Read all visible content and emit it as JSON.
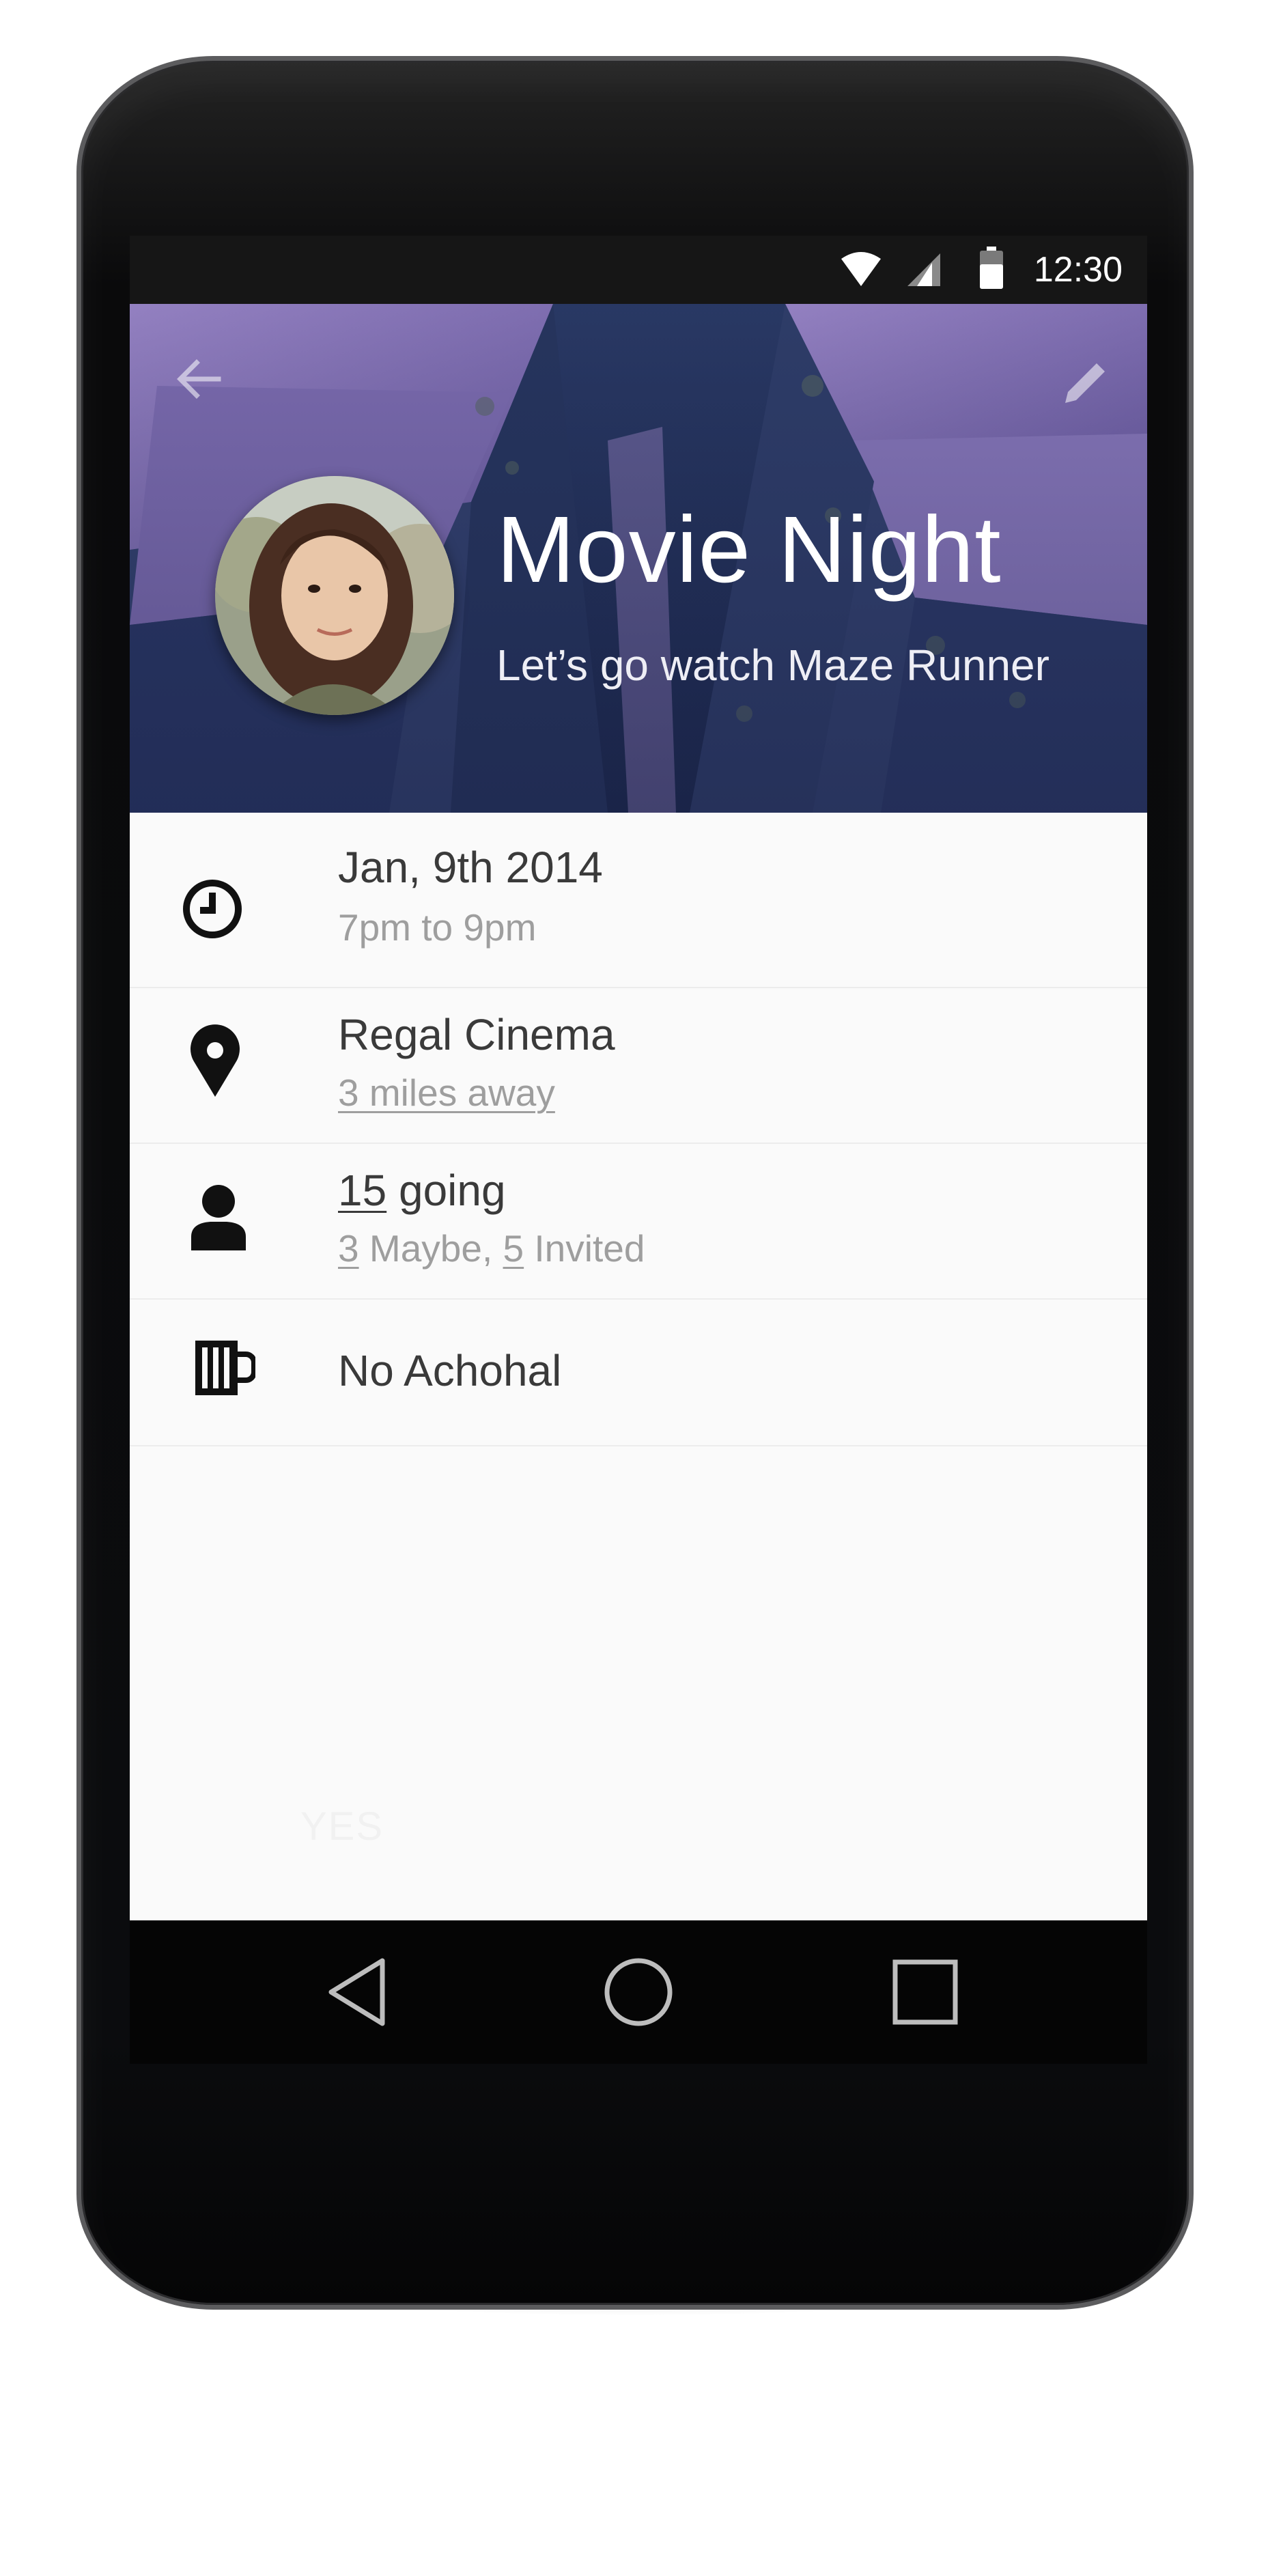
{
  "status_bar": {
    "time": "12:30",
    "icons": [
      "wifi-icon",
      "signal-icon",
      "battery-icon"
    ]
  },
  "header": {
    "back_icon": "arrow-left-icon",
    "edit_icon": "pencil-icon",
    "title": "Movie Night",
    "subtitle": "Let’s go watch Maze Runner"
  },
  "details": {
    "date": {
      "icon": "clock-icon",
      "primary": "Jan, 9th 2014",
      "secondary": "7pm to 9pm"
    },
    "location": {
      "icon": "location-pin-icon",
      "primary": "Regal Cinema",
      "secondary": "3 miles away"
    },
    "attendees": {
      "icon": "person-icon",
      "going_count": "15",
      "going_label": " going",
      "maybe_count": "3",
      "maybe_label": " Maybe, ",
      "invited_count": "5",
      "invited_label": " Invited"
    },
    "alcohol": {
      "icon": "beer-mug-icon",
      "primary": "No Achohal"
    }
  },
  "rsvp": {
    "yes_label": "YES"
  },
  "nav_bar": {
    "back_icon": "nav-back-icon",
    "home_icon": "nav-home-icon",
    "recents_icon": "nav-recents-icon"
  },
  "colors": {
    "header_bg": "#3a4775",
    "accent_purple": "#8f7fc0",
    "screen_bg": "#fafafa",
    "primary_text": "#3a3a3a",
    "secondary_text": "#9e9e9e"
  }
}
